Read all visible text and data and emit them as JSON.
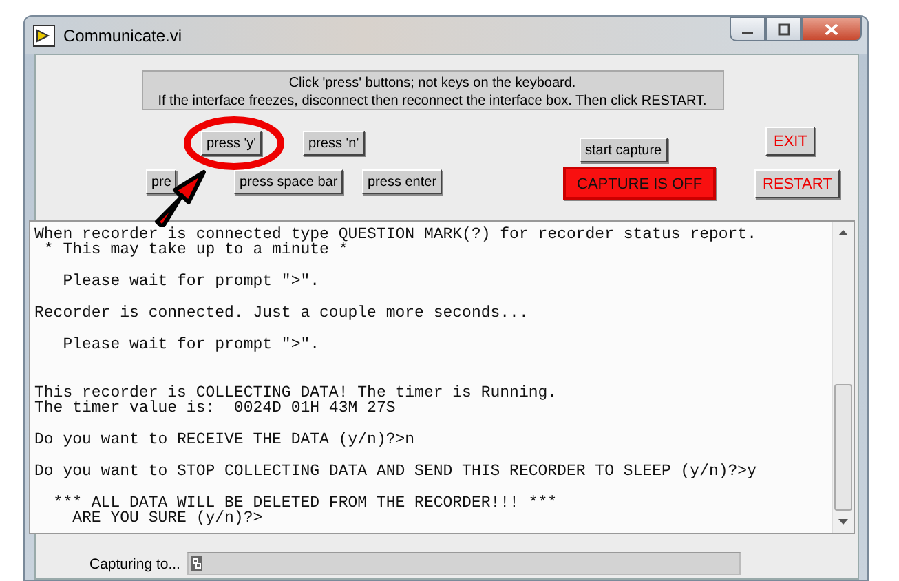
{
  "window": {
    "title": "Communicate.vi"
  },
  "banner": "Click 'press' buttons; not keys on the keyboard.\nIf the interface freezes, disconnect then reconnect the interface box. Then click RESTART.",
  "controls": [
    {
      "label": "press 'y'",
      "kind": "button"
    },
    {
      "label": "press 'n'",
      "kind": "button"
    },
    {
      "label": "start capture",
      "kind": "button"
    },
    {
      "label": "EXIT",
      "kind": "alert-button"
    },
    {
      "label": "pre",
      "kind": "button"
    },
    {
      "label": "press space bar",
      "kind": "button"
    },
    {
      "label": "press enter",
      "kind": "button"
    },
    {
      "label": "CAPTURE IS OFF",
      "kind": "indicator",
      "on": false
    },
    {
      "label": "RESTART",
      "kind": "alert-button"
    }
  ],
  "console_text": "When recorder is connected type QUESTION MARK(?) for recorder status report.\n * This may take up to a minute *\n\n   Please wait for prompt \">\".\n\nRecorder is connected. Just a couple more seconds...\n\n   Please wait for prompt \">\".\n\n\nThis recorder is COLLECTING DATA! The timer is Running.\nThe timer value is:  0024D 01H 43M 27S\n\nDo you want to RECEIVE THE DATA (y/n)?>n\n\nDo you want to STOP COLLECTING DATA AND SEND THIS RECORDER TO SLEEP (y/n)?>y\n\n  *** ALL DATA WILL BE DELETED FROM THE RECORDER!!! ***\n    ARE YOU SURE (y/n)?>",
  "capture": {
    "label": "Capturing to..."
  }
}
